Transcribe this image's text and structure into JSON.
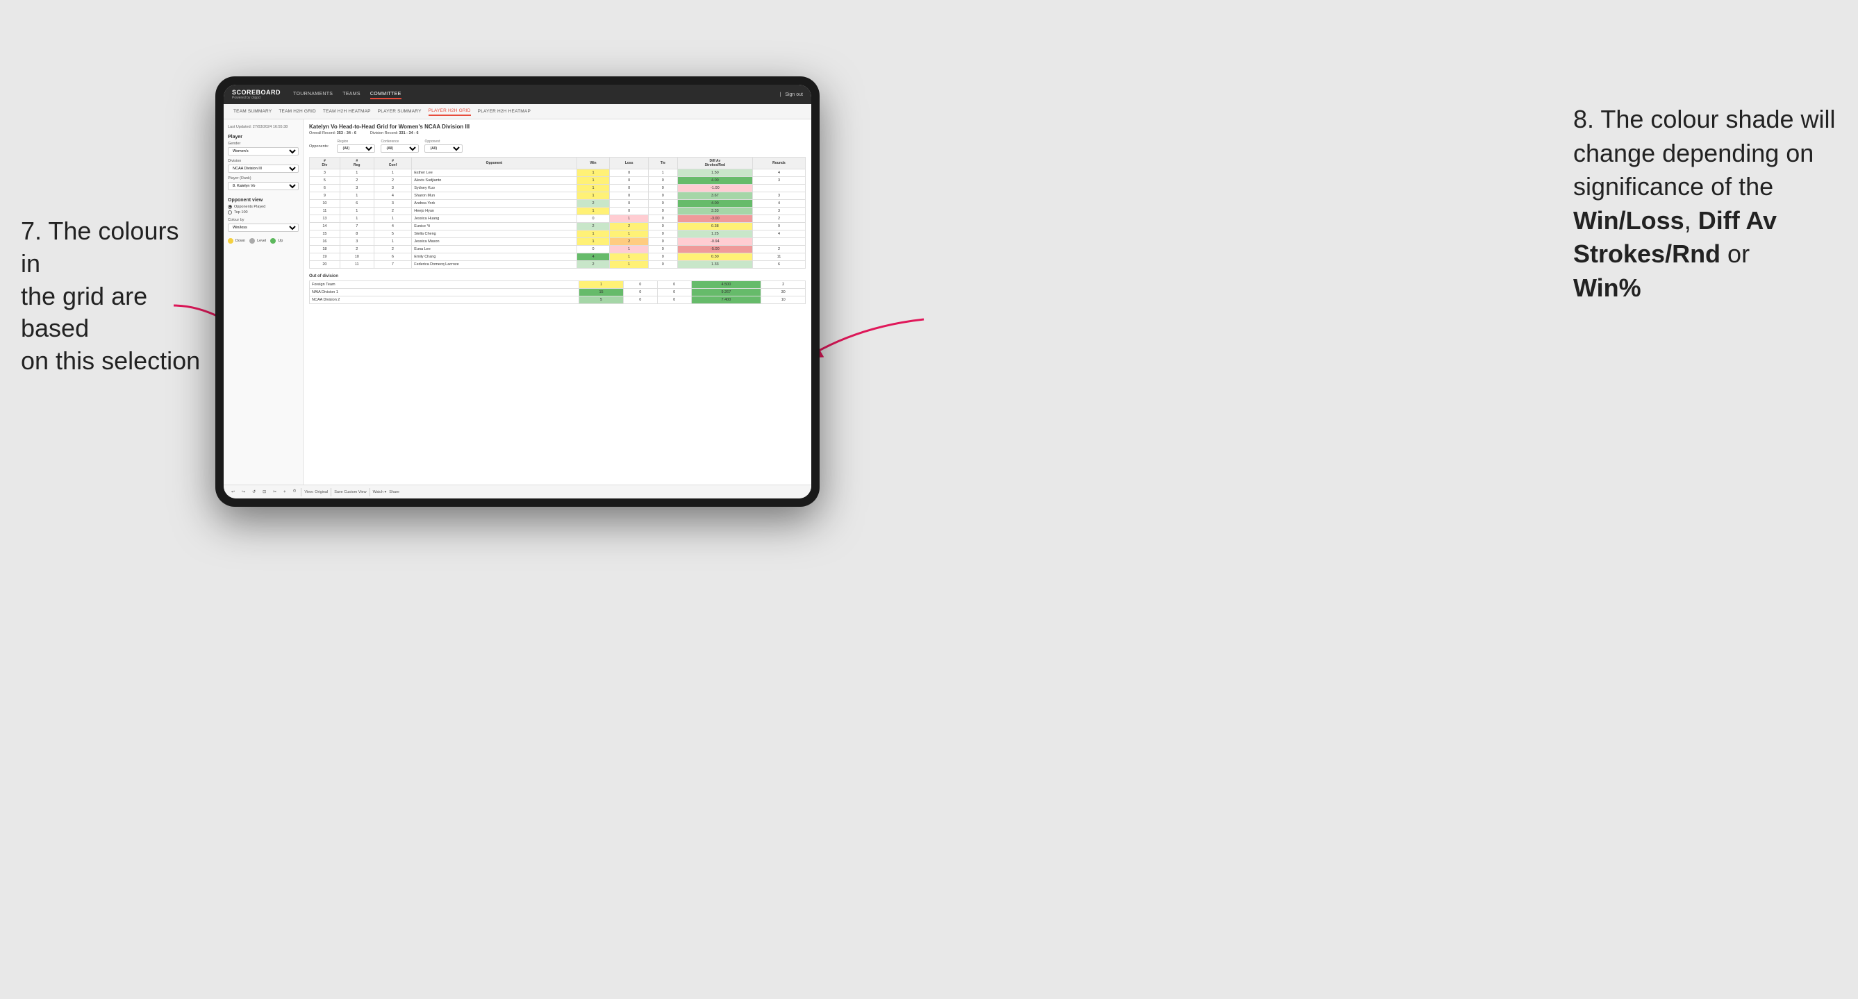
{
  "annotations": {
    "left": {
      "line1": "7. The colours in",
      "line2": "the grid are based",
      "line3": "on this selection"
    },
    "right": {
      "intro": "8. The colour shade will change depending on significance of the",
      "bold1": "Win/Loss",
      "comma": ", ",
      "bold2": "Diff Av Strokes/Rnd",
      "or": " or",
      "bold3": "Win%"
    }
  },
  "nav": {
    "logo": "SCOREBOARD",
    "logo_sub": "Powered by clippd",
    "items": [
      "TOURNAMENTS",
      "TEAMS",
      "COMMITTEE"
    ],
    "active": "COMMITTEE",
    "right": [
      "Sign out"
    ]
  },
  "sub_nav": {
    "items": [
      "TEAM SUMMARY",
      "TEAM H2H GRID",
      "TEAM H2H HEATMAP",
      "PLAYER SUMMARY",
      "PLAYER H2H GRID",
      "PLAYER H2H HEATMAP"
    ],
    "active": "PLAYER H2H GRID"
  },
  "sidebar": {
    "timestamp": "Last Updated: 27/03/2024 16:55:38",
    "section": "Player",
    "gender_label": "Gender",
    "gender_value": "Women's",
    "division_label": "Division",
    "division_value": "NCAA Division III",
    "player_rank_label": "Player (Rank)",
    "player_rank_value": "8. Katelyn Vo",
    "opponent_view_label": "Opponent view",
    "opponent_played": "Opponents Played",
    "top_100": "Top 100",
    "colour_by_label": "Colour by",
    "colour_by_value": "Win/loss",
    "legend": {
      "down_label": "Down",
      "level_label": "Level",
      "up_label": "Up"
    }
  },
  "grid": {
    "title": "Katelyn Vo Head-to-Head Grid for Women's NCAA Division III",
    "overall_record_label": "Overall Record:",
    "overall_record": "353 - 34 - 6",
    "division_record_label": "Division Record:",
    "division_record": "331 - 34 - 6",
    "filters": {
      "opponents_label": "Opponents:",
      "region_label": "Region",
      "region_value": "(All)",
      "conference_label": "Conference",
      "conference_value": "(All)",
      "opponent_label": "Opponent",
      "opponent_value": "(All)"
    },
    "table_headers": [
      "#\nDiv",
      "#\nReg",
      "#\nConf",
      "Opponent",
      "Win",
      "Loss",
      "Tie",
      "Diff Av\nStrokes/Rnd",
      "Rounds"
    ],
    "rows": [
      {
        "div": "3",
        "reg": "1",
        "conf": "1",
        "opponent": "Esther Lee",
        "win": "1",
        "loss": "0",
        "tie": "1",
        "diff": "1.50",
        "rounds": "4",
        "win_color": "yellow",
        "loss_color": "white",
        "tie_color": "white",
        "diff_color": "green_light"
      },
      {
        "div": "5",
        "reg": "2",
        "conf": "2",
        "opponent": "Alexis Sudjianto",
        "win": "1",
        "loss": "0",
        "tie": "0",
        "diff": "4.00",
        "rounds": "3",
        "win_color": "yellow",
        "loss_color": "white",
        "tie_color": "white",
        "diff_color": "green_dark"
      },
      {
        "div": "6",
        "reg": "3",
        "conf": "3",
        "opponent": "Sydney Kuo",
        "win": "1",
        "loss": "0",
        "tie": "0",
        "diff": "-1.00",
        "rounds": "",
        "win_color": "yellow",
        "loss_color": "white",
        "tie_color": "white",
        "diff_color": "red_light"
      },
      {
        "div": "9",
        "reg": "1",
        "conf": "4",
        "opponent": "Sharon Mun",
        "win": "1",
        "loss": "0",
        "tie": "0",
        "diff": "3.67",
        "rounds": "3",
        "win_color": "yellow",
        "loss_color": "white",
        "tie_color": "white",
        "diff_color": "green_med"
      },
      {
        "div": "10",
        "reg": "6",
        "conf": "3",
        "opponent": "Andrea York",
        "win": "2",
        "loss": "0",
        "tie": "0",
        "diff": "4.00",
        "rounds": "4",
        "win_color": "green_light",
        "loss_color": "white",
        "tie_color": "white",
        "diff_color": "green_dark"
      },
      {
        "div": "11",
        "reg": "1",
        "conf": "2",
        "opponent": "Heejo Hyun",
        "win": "1",
        "loss": "0",
        "tie": "0",
        "diff": "3.33",
        "rounds": "3",
        "win_color": "yellow",
        "loss_color": "white",
        "tie_color": "white",
        "diff_color": "green_med"
      },
      {
        "div": "13",
        "reg": "1",
        "conf": "1",
        "opponent": "Jessica Huang",
        "win": "0",
        "loss": "1",
        "tie": "0",
        "diff": "-3.00",
        "rounds": "2",
        "win_color": "white",
        "loss_color": "red_light",
        "tie_color": "white",
        "diff_color": "red"
      },
      {
        "div": "14",
        "reg": "7",
        "conf": "4",
        "opponent": "Eunice Yi",
        "win": "2",
        "loss": "2",
        "tie": "0",
        "diff": "0.38",
        "rounds": "9",
        "win_color": "green_light",
        "loss_color": "yellow",
        "tie_color": "white",
        "diff_color": "yellow"
      },
      {
        "div": "15",
        "reg": "8",
        "conf": "5",
        "opponent": "Stella Cheng",
        "win": "1",
        "loss": "1",
        "tie": "0",
        "diff": "1.25",
        "rounds": "4",
        "win_color": "yellow",
        "loss_color": "yellow",
        "tie_color": "white",
        "diff_color": "green_light"
      },
      {
        "div": "16",
        "reg": "3",
        "conf": "1",
        "opponent": "Jessica Mason",
        "win": "1",
        "loss": "2",
        "tie": "0",
        "diff": "-0.94",
        "rounds": "",
        "win_color": "yellow",
        "loss_color": "orange",
        "tie_color": "white",
        "diff_color": "red_light"
      },
      {
        "div": "18",
        "reg": "2",
        "conf": "2",
        "opponent": "Euna Lee",
        "win": "0",
        "loss": "1",
        "tie": "0",
        "diff": "-5.00",
        "rounds": "2",
        "win_color": "white",
        "loss_color": "red_light",
        "tie_color": "white",
        "diff_color": "red"
      },
      {
        "div": "19",
        "reg": "10",
        "conf": "6",
        "opponent": "Emily Chang",
        "win": "4",
        "loss": "1",
        "tie": "0",
        "diff": "0.30",
        "rounds": "11",
        "win_color": "green_dark",
        "loss_color": "yellow",
        "tie_color": "white",
        "diff_color": "yellow"
      },
      {
        "div": "20",
        "reg": "11",
        "conf": "7",
        "opponent": "Federica Domecq Lacroze",
        "win": "2",
        "loss": "1",
        "tie": "0",
        "diff": "1.33",
        "rounds": "6",
        "win_color": "green_light",
        "loss_color": "yellow",
        "tie_color": "white",
        "diff_color": "green_light"
      }
    ],
    "out_of_division_label": "Out of division",
    "out_of_division_rows": [
      {
        "opponent": "Foreign Team",
        "win": "1",
        "loss": "0",
        "tie": "0",
        "diff": "4.500",
        "rounds": "2",
        "win_color": "yellow",
        "diff_color": "green_dark"
      },
      {
        "opponent": "NAIA Division 1",
        "win": "15",
        "loss": "0",
        "tie": "0",
        "diff": "9.267",
        "rounds": "30",
        "win_color": "green_dark",
        "diff_color": "green_dark"
      },
      {
        "opponent": "NCAA Division 2",
        "win": "5",
        "loss": "0",
        "tie": "0",
        "diff": "7.400",
        "rounds": "10",
        "win_color": "green_med",
        "diff_color": "green_dark"
      }
    ]
  },
  "toolbar": {
    "buttons": [
      "↩",
      "↪",
      "↺",
      "⊡",
      "✂",
      "⊕",
      "⏱"
    ],
    "view_label": "View: Original",
    "save_label": "Save Custom View",
    "watch_label": "Watch ▾",
    "share_label": "Share"
  }
}
